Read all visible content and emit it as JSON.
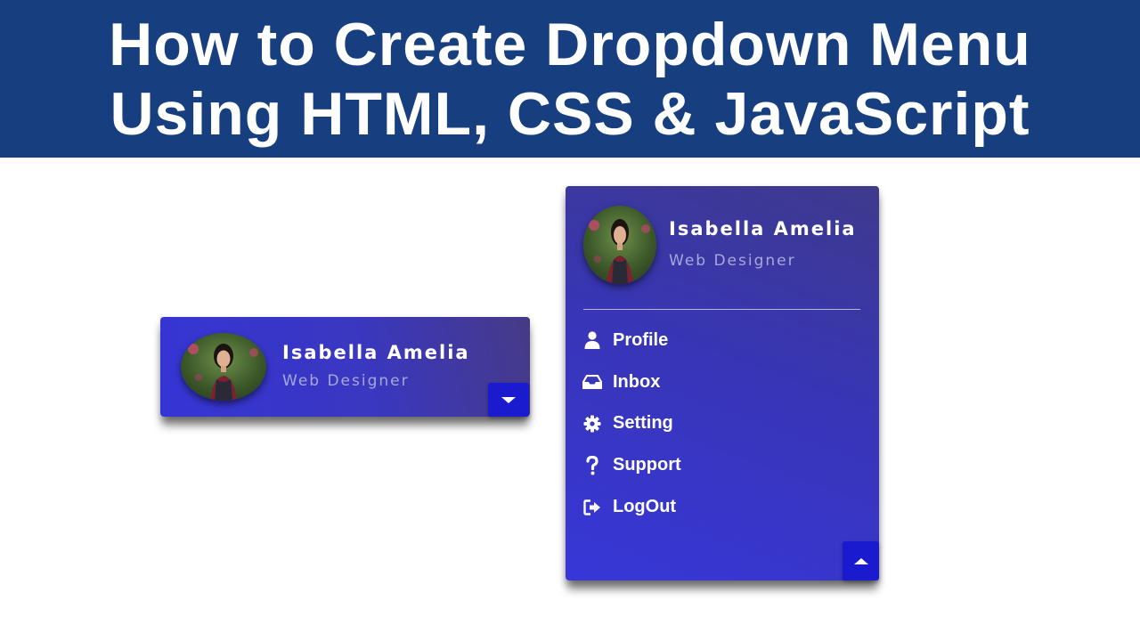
{
  "banner": {
    "line1": "How to Create Dropdown Menu",
    "line2": "Using HTML, CSS & JavaScript"
  },
  "colors": {
    "banner_bg": "#173f80",
    "card_primary": "#3737d8",
    "toggle_button": "#1a1acf",
    "role_text": "#a7a8d8"
  },
  "card_closed": {
    "user": {
      "name": "Isabella Amelia",
      "role": "Web Designer"
    },
    "toggle_icon": "caret-down-icon"
  },
  "card_open": {
    "user": {
      "name": "Isabella Amelia",
      "role": "Web Designer"
    },
    "menu": [
      {
        "label": "Profile",
        "icon": "user-icon"
      },
      {
        "label": "Inbox",
        "icon": "inbox-icon"
      },
      {
        "label": "Setting",
        "icon": "gear-icon"
      },
      {
        "label": "Support",
        "icon": "question-icon"
      },
      {
        "label": "LogOut",
        "icon": "logout-icon"
      }
    ],
    "toggle_icon": "caret-up-icon"
  }
}
